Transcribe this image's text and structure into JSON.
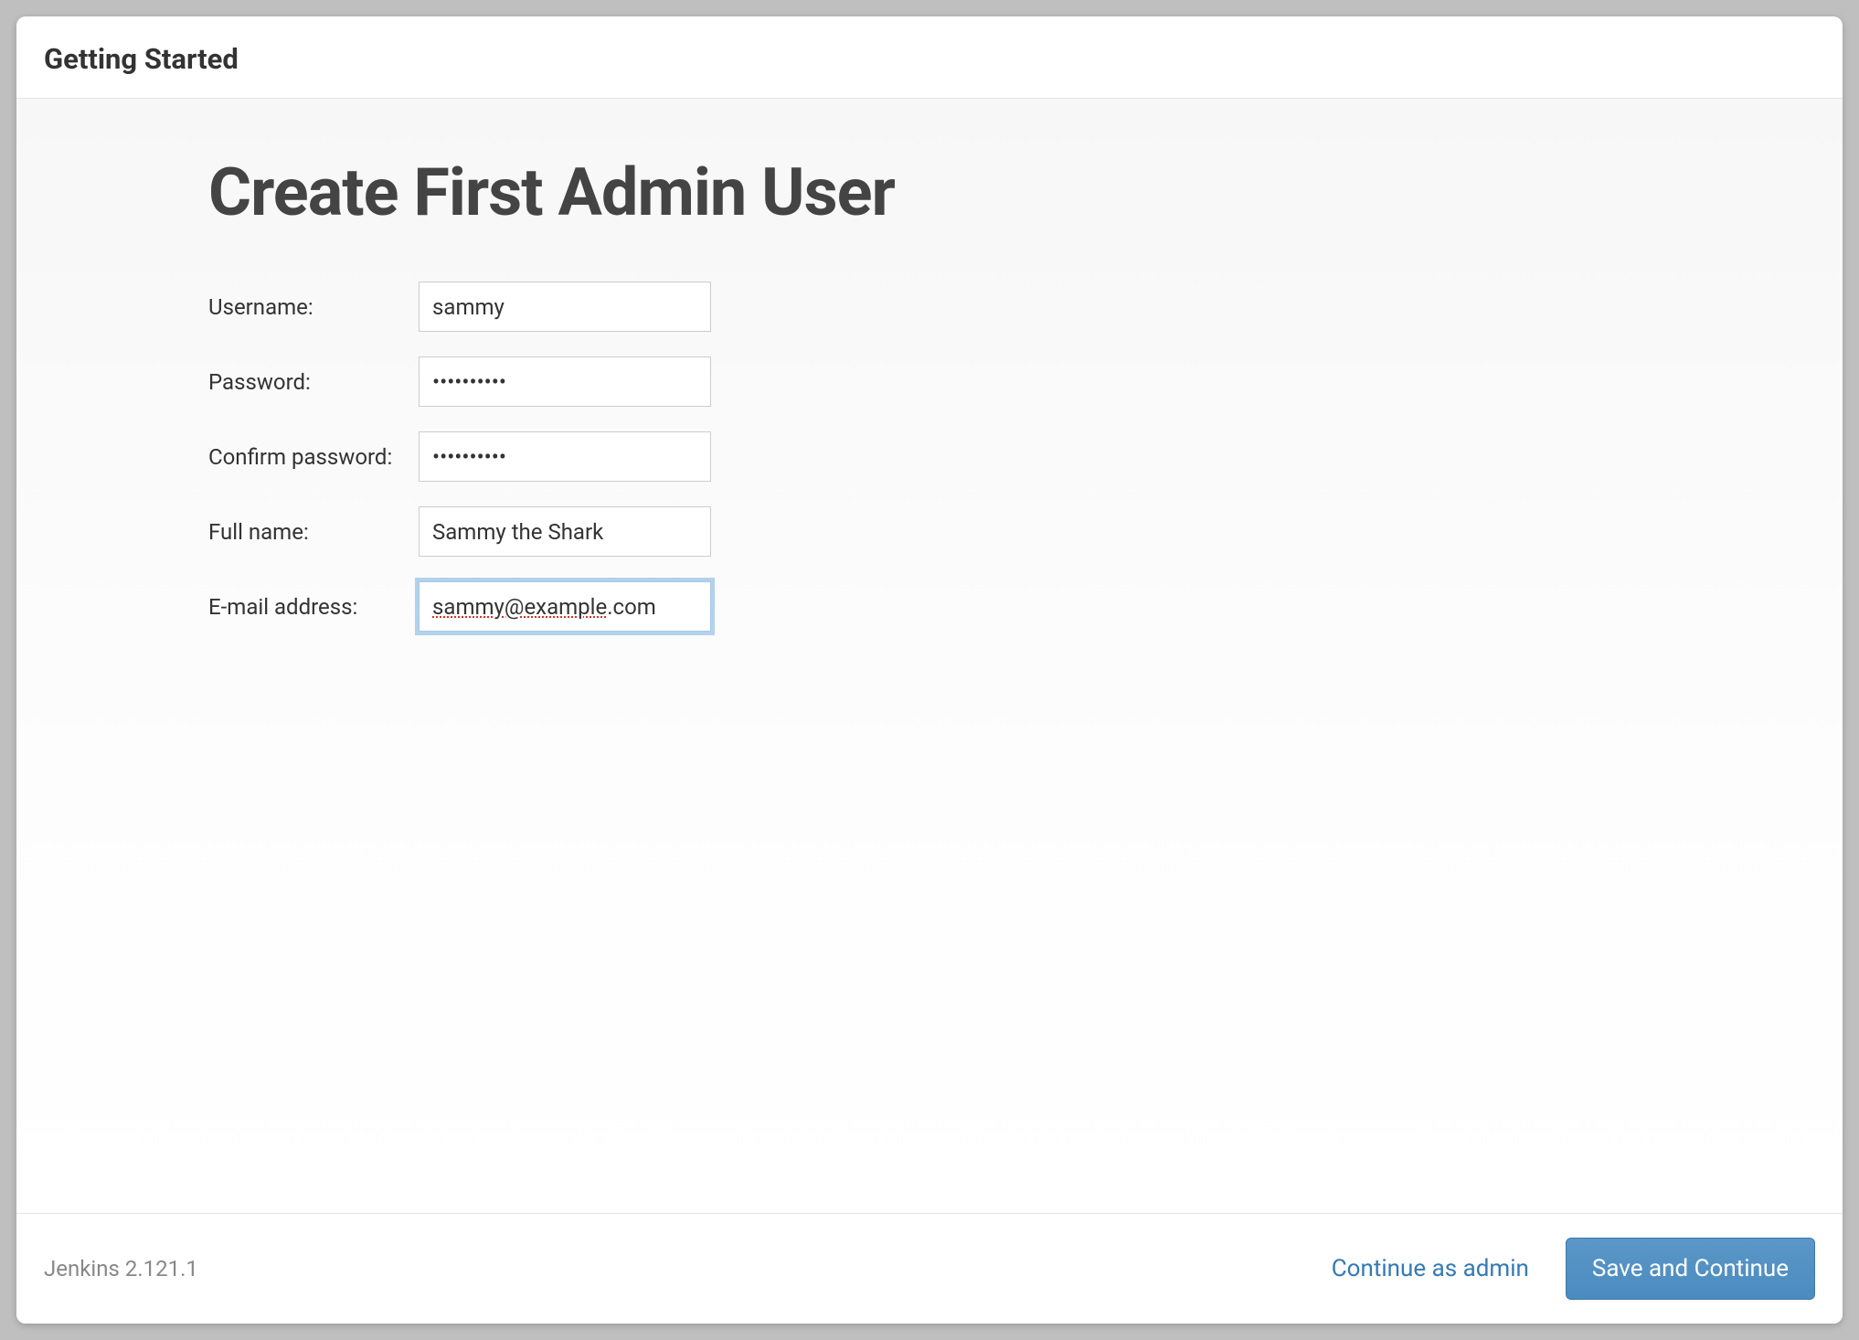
{
  "header": {
    "title": "Getting Started"
  },
  "main": {
    "heading": "Create First Admin User",
    "fields": {
      "username": {
        "label": "Username:",
        "value": "sammy"
      },
      "password": {
        "label": "Password:",
        "value": "••••••••••"
      },
      "confirm_password": {
        "label": "Confirm password:",
        "value": "••••••••••"
      },
      "full_name": {
        "label": "Full name:",
        "value": "Sammy the Shark"
      },
      "email": {
        "label": "E-mail address:",
        "value_part1": "sammy@example",
        "value_part2": ".com"
      }
    }
  },
  "footer": {
    "version": "Jenkins 2.121.1",
    "continue_as_admin_label": "Continue as admin",
    "save_continue_label": "Save and Continue"
  }
}
